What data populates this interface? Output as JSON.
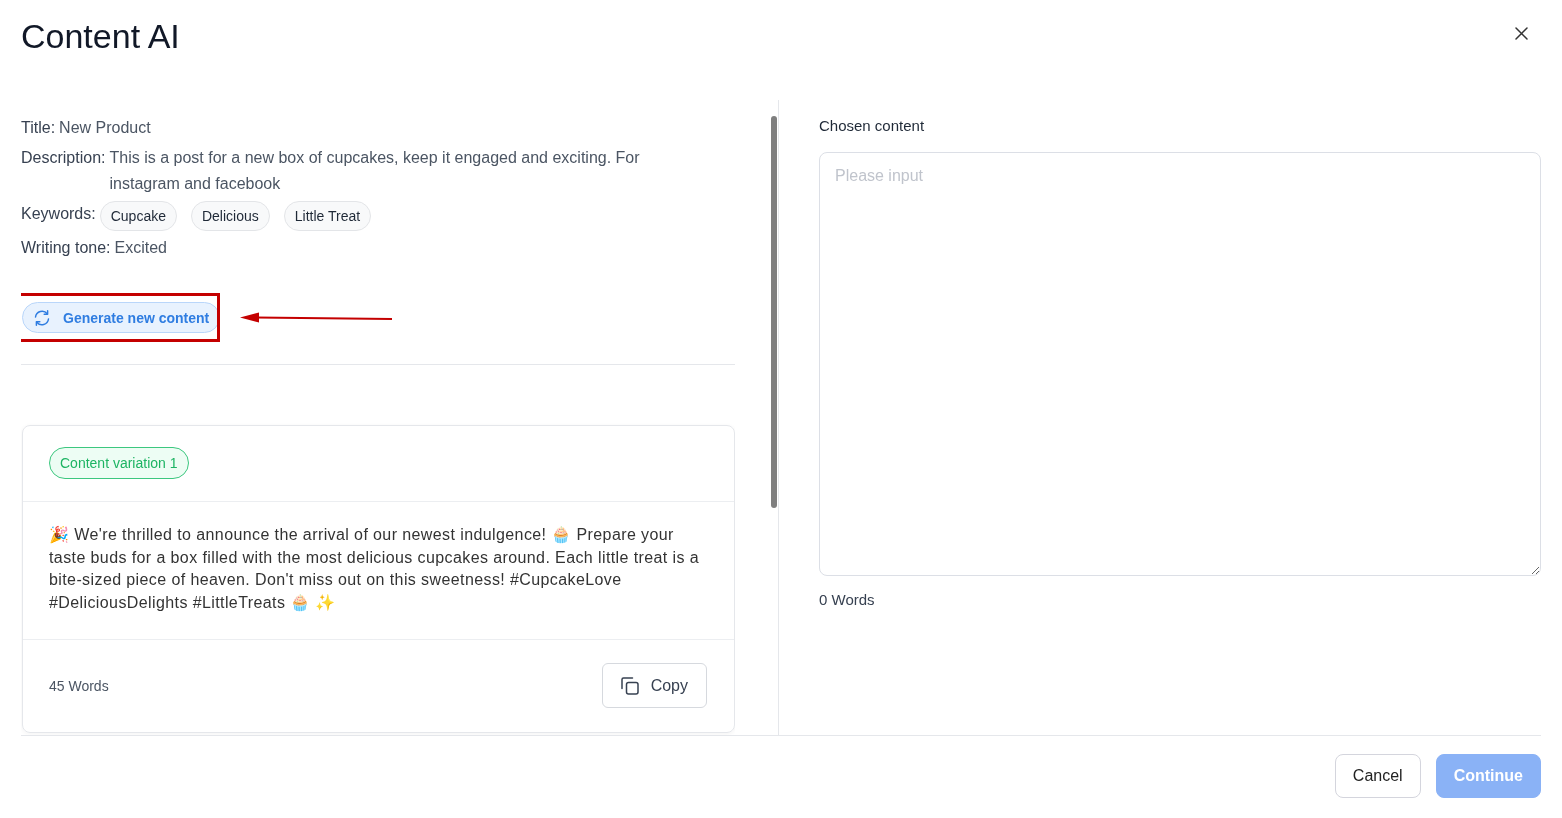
{
  "window": {
    "title": "Content AI"
  },
  "brief": {
    "fields": [
      {
        "kind": "text",
        "label": "Title:",
        "value": "New Product"
      },
      {
        "kind": "text",
        "label": "Description:",
        "value": "This is a post for a new box of cupcakes, keep it engaged and exciting. For instagram and facebook"
      },
      {
        "kind": "tags",
        "label": "Keywords:",
        "tags": [
          "Cupcake",
          "Delicious",
          "Little Treat"
        ]
      },
      {
        "kind": "text",
        "label": "Writing tone:",
        "value": "Excited"
      }
    ]
  },
  "generate_button": {
    "label": "Generate new content"
  },
  "variations": [
    {
      "tag": "Content variation 1",
      "text": "🎉 We're thrilled to announce the arrival of our newest indulgence! 🧁 Prepare your taste buds for a box filled with the most delicious cupcakes around. Each little treat is a bite-sized piece of heaven. Don't miss out on this sweetness! #CupcakeLove #DeliciousDelights #LittleTreats 🧁 ✨",
      "word_count": "45 Words",
      "copy_button": "Copy"
    }
  ],
  "chosen_content": {
    "label": "Chosen content",
    "placeholder": "Please input",
    "word_count": "0 Words"
  },
  "footer": {
    "buttons": [
      {
        "label": "Cancel",
        "kind": "secondary",
        "disabled": false
      },
      {
        "label": "Continue",
        "kind": "primary",
        "disabled": true
      }
    ]
  }
}
